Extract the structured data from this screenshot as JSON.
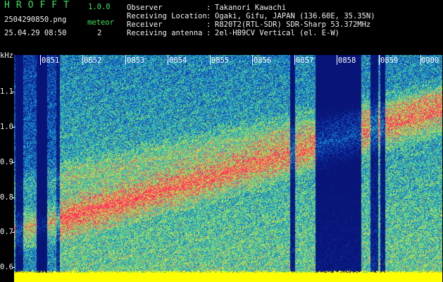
{
  "header": {
    "app_title": "HROFFT",
    "app_version": "1.0.0",
    "file_name": "2504290850.png",
    "timestamp": "25.04.29 08:50",
    "meteor_label": "meteor",
    "meteor_count": "2"
  },
  "info": [
    {
      "label": "Observer",
      "value": "Takanori Kawachi"
    },
    {
      "label": "Receiving Location",
      "value": "Ogaki, Gifu, JAPAN (136.60E, 35.35N)"
    },
    {
      "label": "Receiver",
      "value": "R820T2(RTL-SDR) SDR-Sharp 53.372MHz"
    },
    {
      "label": "Receiving antenna",
      "value": "2el-HB9CV Vertical (el. E-W)"
    }
  ],
  "info_separator": ":",
  "spectrogram": {
    "y_unit": "kHz",
    "y_ticks": [
      "1.1",
      "1.0",
      "0.9",
      "0.8",
      "0.7",
      "0.6"
    ],
    "y_range_khz": [
      0.57,
      1.2
    ],
    "x_ticks": [
      "0851",
      "0852",
      "0853",
      "0854",
      "0855",
      "0856",
      "0857",
      "0858",
      "0859",
      "0900"
    ],
    "x_range_minutes": [
      0,
      10
    ],
    "palette": {
      "low": "#0a1f8f",
      "mid_low": "#1aa7c9",
      "mid": "#6fe06a",
      "high": "#e8e83a",
      "peak": "#ff2a6a",
      "noise_floor": "#ffff00"
    }
  }
}
